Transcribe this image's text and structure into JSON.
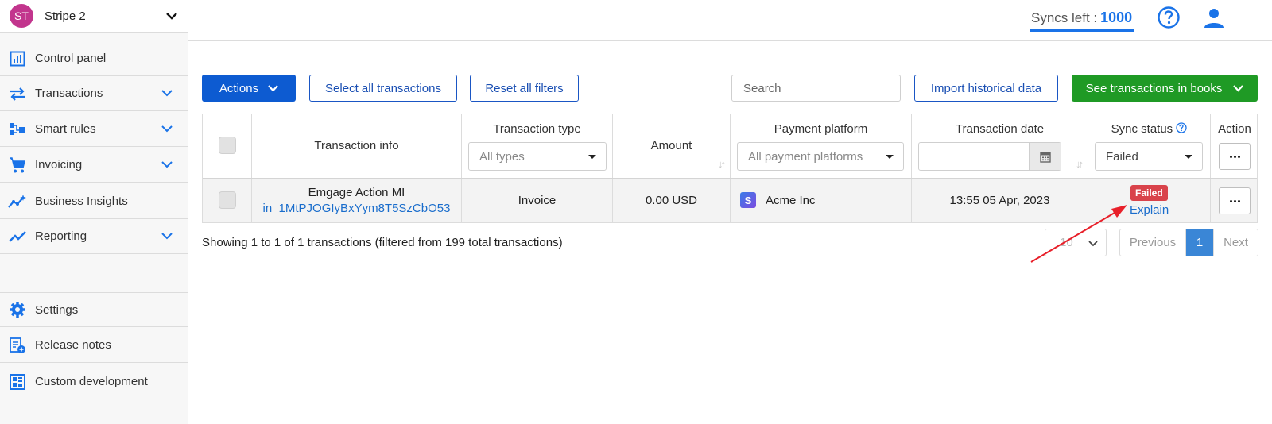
{
  "account": {
    "initials": "ST",
    "name": "Stripe 2"
  },
  "sidebar": {
    "items": [
      {
        "label": "Control panel",
        "icon": "dashboard-icon"
      },
      {
        "label": "Transactions",
        "icon": "transfer-icon"
      },
      {
        "label": "Smart rules",
        "icon": "smart-rules-icon"
      },
      {
        "label": "Invoicing",
        "icon": "cart-icon"
      },
      {
        "label": "Business Insights",
        "icon": "insights-icon"
      },
      {
        "label": "Reporting",
        "icon": "trend-icon"
      },
      {
        "label": "Settings",
        "icon": "gear-icon"
      },
      {
        "label": "Release notes",
        "icon": "release-notes-icon"
      },
      {
        "label": "Custom development",
        "icon": "custom-dev-icon"
      }
    ]
  },
  "header": {
    "syncs_label": "Syncs left :",
    "syncs_count": "1000"
  },
  "toolbar": {
    "actions": "Actions",
    "select_all": "Select all transactions",
    "reset_filters": "Reset all filters",
    "search_placeholder": "Search",
    "import": "Import historical data",
    "see_in_books": "See transactions in books"
  },
  "table": {
    "headers": {
      "info": "Transaction info",
      "type": "Transaction type",
      "amount": "Amount",
      "platform": "Payment platform",
      "date": "Transaction date",
      "sync": "Sync status",
      "action": "Action"
    },
    "filters": {
      "type": "All types",
      "platform": "All payment platforms",
      "sync": "Failed"
    },
    "rows": [
      {
        "name": "Emgage Action MI",
        "id": "in_1MtPJOGIyBxYym8T5SzCbO53",
        "type": "Invoice",
        "amount": "0.00 USD",
        "platform_logo": "S",
        "platform": "Acme Inc",
        "date": "13:55 05 Apr, 2023",
        "status": "Failed",
        "explain": "Explain"
      }
    ]
  },
  "footer": {
    "showing": "Showing 1 to 1 of 1 transactions (filtered from 199 total transactions)",
    "page_size": "10",
    "prev": "Previous",
    "page": "1",
    "next": "Next"
  },
  "colors": {
    "primary": "#0d5bd1",
    "success": "#1f9a25",
    "danger": "#d9434b",
    "link": "#1a6dcc",
    "annotation": "#e8202a"
  }
}
